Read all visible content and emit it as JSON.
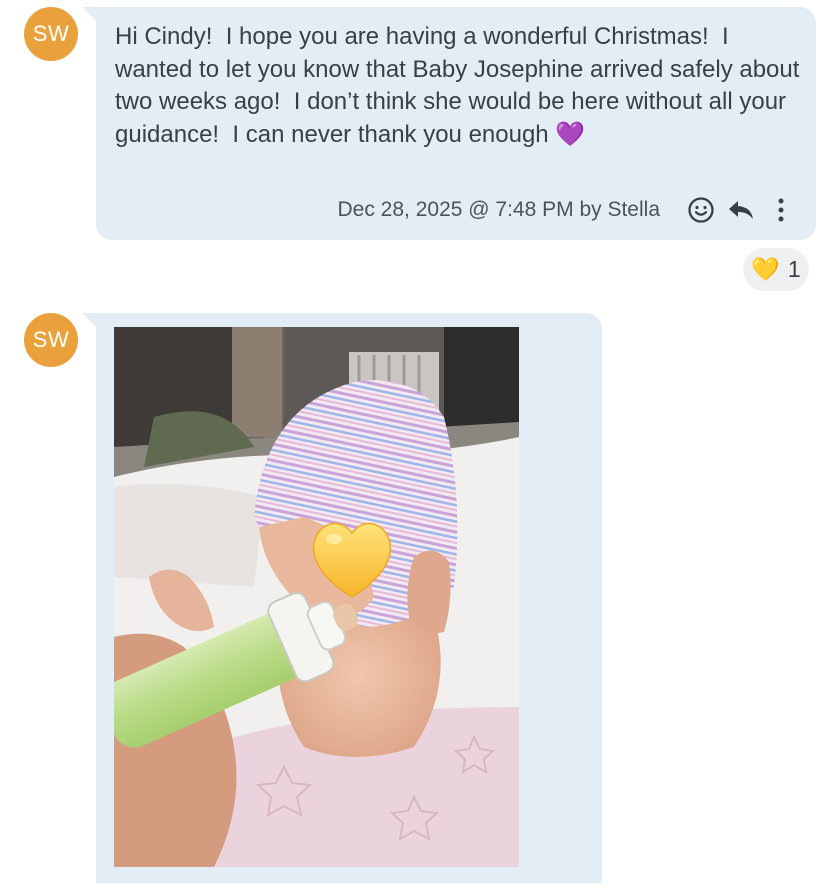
{
  "messages": [
    {
      "avatar_initials": "SW",
      "text": "Hi Cindy!  I hope you are having a wonderful Christmas!  I wanted to let you know that Baby Josephine arrived safely about two weeks ago!  I don’t think she would be here without all your guidance!  I can never thank you enough 💜",
      "meta": "Dec 28, 2025 @ 7:48 PM by Stella",
      "actions": [
        "smiley-icon",
        "reply-icon",
        "more-vertical-icon"
      ],
      "reaction": {
        "emoji": "💛",
        "count": "1"
      }
    },
    {
      "avatar_initials": "SW",
      "attachment": {
        "type": "image",
        "overlay_emoji": "💛"
      }
    }
  ],
  "colors": {
    "avatar": "#e9a23b",
    "bubble": "#e3edf6",
    "text": "#3a3f45",
    "reaction_pill": "#eef0f2"
  }
}
